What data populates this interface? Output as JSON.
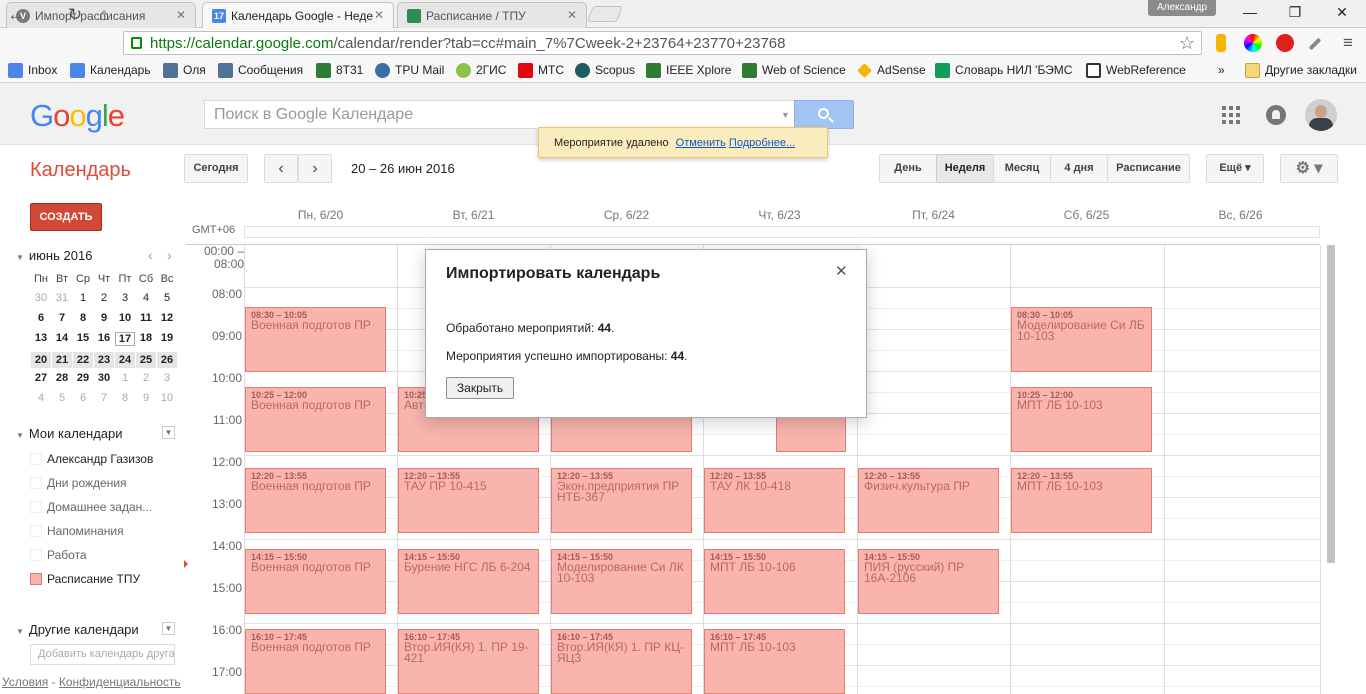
{
  "browser": {
    "tabs": [
      {
        "label": "Импорт расписания",
        "icon": "gear-icon",
        "color": "#7a7a7a"
      },
      {
        "label": "Календарь Google - Неде",
        "icon": "calendar-icon",
        "color": "#4a86e8",
        "badge": "17"
      },
      {
        "label": "Расписание / ТПУ",
        "icon": "spreadsheet-icon",
        "color": "#2e8b57"
      }
    ],
    "user": "Александр",
    "url_scheme": "https://",
    "url_host": "calendar.google.com",
    "url_path": "/calendar/render?tab=cc#main_7%7Cweek-2+23764+23770+23768",
    "bookmarks": [
      "Inbox",
      "Календарь",
      "Оля",
      "Сообщения",
      "8Т31",
      "TPU Mail",
      "2ГИС",
      "МТС",
      "Scopus",
      "IEEE Xplore",
      "Web of Science",
      "AdSense",
      "Словарь НИЛ 'БЭМС",
      "WebReference"
    ],
    "bookmarks_more": "»",
    "other_bookmarks": "Другие закладки"
  },
  "header": {
    "logo": "Google",
    "search_placeholder": "Поиск в Google Календаре"
  },
  "toast": {
    "message": "Мероприятие удалено",
    "undo": "Отменить",
    "details": "Подробнее..."
  },
  "toolbar": {
    "title": "Календарь",
    "today": "Сегодня",
    "range": "20 – 26 июн 2016",
    "views": [
      "День",
      "Неделя",
      "Месяц",
      "4 дня",
      "Расписание"
    ],
    "selected_view": "Неделя",
    "more": "Ещё ▾",
    "create": "СОЗДАТЬ"
  },
  "mini_calendar": {
    "month": "июнь 2016",
    "weekdays": [
      "Пн",
      "Вт",
      "Ср",
      "Чт",
      "Пт",
      "Сб",
      "Вс"
    ],
    "weeks": [
      [
        "30",
        "31",
        "1",
        "2",
        "3",
        "4",
        "5"
      ],
      [
        "6",
        "7",
        "8",
        "9",
        "10",
        "11",
        "12"
      ],
      [
        "13",
        "14",
        "15",
        "16",
        "17",
        "18",
        "19"
      ],
      [
        "20",
        "21",
        "22",
        "23",
        "24",
        "25",
        "26"
      ],
      [
        "27",
        "28",
        "29",
        "30",
        "1",
        "2",
        "3"
      ],
      [
        "4",
        "5",
        "6",
        "7",
        "8",
        "9",
        "10"
      ]
    ],
    "today": "17"
  },
  "my_calendars": {
    "title": "Мои календари",
    "items": [
      "Александр Газизов",
      "Дни рождения",
      "Домашнее задан...",
      "Напоминания",
      "Работа",
      "Расписание ТПУ"
    ],
    "active_color": "#f8b4ad"
  },
  "other_calendars": {
    "title": "Другие календари",
    "placeholder": "Добавить календарь друга"
  },
  "footer": {
    "terms": "Условия",
    "sep": " - ",
    "privacy": "Конфиденциальность"
  },
  "week": {
    "timezone": "GMT+06",
    "days": [
      "Пн, 6/20",
      "Вт, 6/21",
      "Ср, 6/22",
      "Чт, 6/23",
      "Пт, 6/24",
      "Сб, 6/25",
      "Вс, 6/26"
    ],
    "allday_label": "00:00 – 08:00",
    "hours": [
      "08:00",
      "09:00",
      "10:00",
      "11:00",
      "12:00",
      "13:00",
      "14:00",
      "15:00",
      "16:00",
      "17:00"
    ],
    "events": [
      {
        "day": 0,
        "slot": 0,
        "time": "08:30 – 10:05",
        "title": "Военная подготов ПР"
      },
      {
        "day": 5,
        "slot": 0,
        "time": "08:30 – 10:05",
        "title": "Моделирование Си ЛБ 10-103"
      },
      {
        "day": 0,
        "slot": 1,
        "time": "10:25 – 12:00",
        "title": "Военная подготов ПР"
      },
      {
        "day": 1,
        "slot": 1,
        "time": "10:25",
        "title": "Авт-  10-107"
      },
      {
        "day": 2,
        "slot": 1,
        "time": "",
        "title": "10-103"
      },
      {
        "day": 3,
        "slot": 1,
        "time": "",
        "title": "ЛБ 10-115",
        "narrow": true
      },
      {
        "day": 5,
        "slot": 1,
        "time": "10:25 – 12:00",
        "title": "МПТ ЛБ 10-103"
      },
      {
        "day": 0,
        "slot": 2,
        "time": "12:20 – 13:55",
        "title": "Военная подготов ПР"
      },
      {
        "day": 1,
        "slot": 2,
        "time": "12:20 – 13:55",
        "title": "ТАУ ПР 10-415"
      },
      {
        "day": 2,
        "slot": 2,
        "time": "12:20 – 13:55",
        "title": "Экон.предприятия ПР НТБ-367"
      },
      {
        "day": 3,
        "slot": 2,
        "time": "12:20 – 13:55",
        "title": "ТАУ ЛК 10-418"
      },
      {
        "day": 4,
        "slot": 2,
        "time": "12:20 – 13:55",
        "title": "Физич.культура ПР"
      },
      {
        "day": 5,
        "slot": 2,
        "time": "12:20 – 13:55",
        "title": "МПТ ЛБ 10-103"
      },
      {
        "day": 0,
        "slot": 3,
        "time": "14:15 – 15:50",
        "title": "Военная подготов ПР"
      },
      {
        "day": 1,
        "slot": 3,
        "time": "14:15 – 15:50",
        "title": "Бурение НГС ЛБ 6-204"
      },
      {
        "day": 2,
        "slot": 3,
        "time": "14:15 – 15:50",
        "title": "Моделирование Си ЛК 10-103"
      },
      {
        "day": 3,
        "slot": 3,
        "time": "14:15 – 15:50",
        "title": "МПТ ЛБ 10-106"
      },
      {
        "day": 4,
        "slot": 3,
        "time": "14:15 – 15:50",
        "title": "ПИЯ (русский) ПР 16А-2106"
      },
      {
        "day": 0,
        "slot": 4,
        "time": "16:10 – 17:45",
        "title": "Военная подготов ПР"
      },
      {
        "day": 1,
        "slot": 4,
        "time": "16:10 – 17:45",
        "title": "Втор.ИЯ(КЯ) 1. ПР 19-421"
      },
      {
        "day": 2,
        "slot": 4,
        "time": "16:10 – 17:45",
        "title": "Втор.ИЯ(КЯ) 1. ПР КЦ-ЯЦ3"
      },
      {
        "day": 3,
        "slot": 4,
        "time": "16:10 – 17:45",
        "title": "МПТ ЛБ 10-103"
      }
    ]
  },
  "dialog": {
    "title": "Импортировать календарь",
    "processed_label": "Обработано мероприятий:",
    "processed_value": "44",
    "imported_label": "Мероприятия успешно импортированы:",
    "imported_value": "44",
    "close_button": "Закрыть"
  }
}
